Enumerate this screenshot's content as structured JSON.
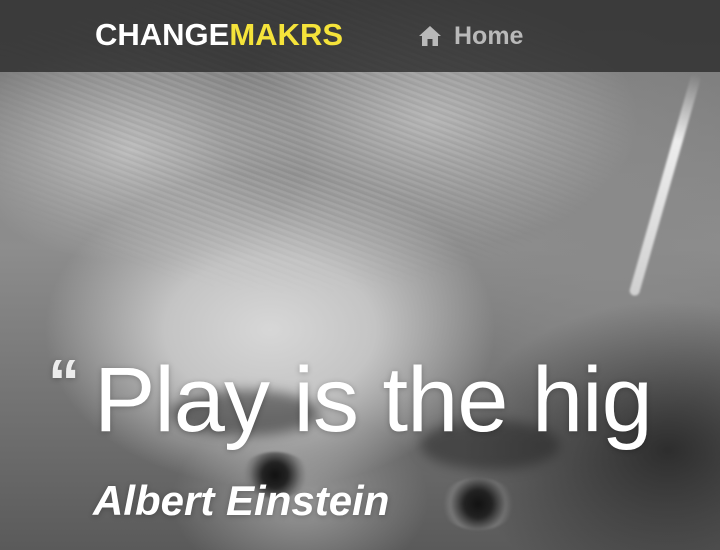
{
  "nav": {
    "brand_primary": "CHANGE",
    "brand_accent": "MAKRS",
    "brand_primary_color": "#ffffff",
    "brand_accent_color": "#f5e33a",
    "home_icon": "home-icon",
    "home_label": "Home"
  },
  "hero": {
    "quote_mark": "“",
    "quote_text": "Play is the hig",
    "author": "Albert Einstein"
  }
}
